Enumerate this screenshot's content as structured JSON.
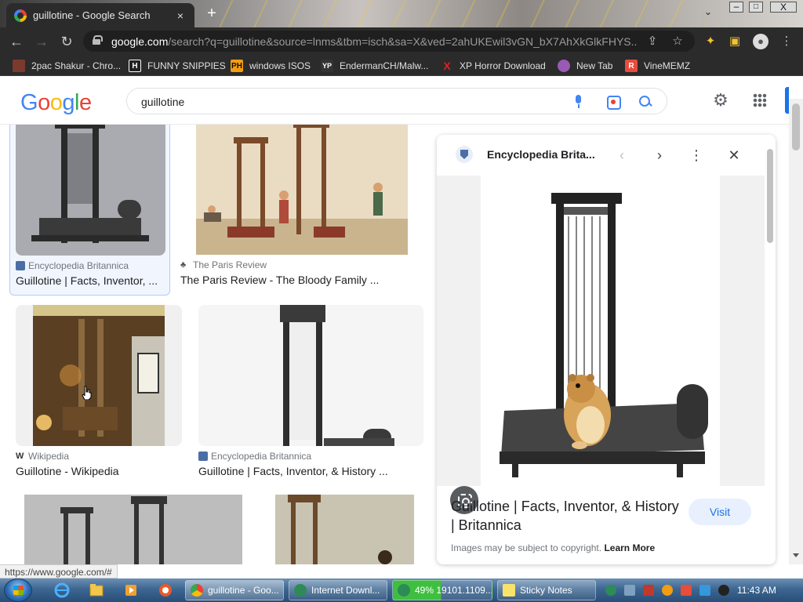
{
  "browser": {
    "tab_title": "guillotine - Google Search",
    "tab_close": "×",
    "new_tab": "+",
    "url_domain": "google.com",
    "url_rest": "/search?q=guillotine&source=lnms&tbm=isch&sa=X&ved=2ahUKEwil3vGN_bX7AhXkGlkFHYS...",
    "window_controls": {
      "minimize": "–",
      "maximize": "□",
      "close": "X"
    }
  },
  "bookmarks": [
    {
      "label": "2pac Shakur - Chro...",
      "icon_text": "",
      "color": "#7a3b2e"
    },
    {
      "label": "FUNNY SNIPPIES",
      "icon_text": "H",
      "color": "#222222"
    },
    {
      "label": "windows ISOS",
      "icon_text": "PH",
      "color": "#f39c12"
    },
    {
      "label": "EndermanCH/Malw...",
      "icon_text": "YP",
      "color": "#333333"
    },
    {
      "label": "XP Horror Download",
      "icon_text": "X",
      "color": "#2b2b2b"
    },
    {
      "label": "New Tab",
      "icon_text": "",
      "color": "#9b59b6"
    },
    {
      "label": "VineMEMZ",
      "icon_text": "R",
      "color": "#e74c3c"
    }
  ],
  "google": {
    "logo_letters": [
      "G",
      "o",
      "o",
      "g",
      "l",
      "e"
    ],
    "query": "guillotine"
  },
  "results": [
    {
      "source": "Encyclopedia Britannica",
      "title": "Guillotine | Facts, Inventor, ..."
    },
    {
      "source": "The Paris Review",
      "title": "The Paris Review - The Bloody Family ..."
    },
    {
      "source": "Wikipedia",
      "title": "Guillotine - Wikipedia"
    },
    {
      "source": "Encyclopedia Britannica",
      "title": "Guillotine | Facts, Inventor, & History ..."
    }
  ],
  "panel": {
    "source": "Encyclopedia Brita...",
    "title": "Guillotine | Facts, Inventor, & History | Britannica",
    "visit_label": "Visit",
    "copyright_text": "Images may be subject to copyright.",
    "learn_more": "Learn More",
    "prev": "‹",
    "next": "›",
    "more": "⋮",
    "close": "✕"
  },
  "status_url": "https://www.google.com/#",
  "taskbar": {
    "tasks": [
      {
        "label": "guillotine - Goo...",
        "color": "#4285f4"
      },
      {
        "label": "Internet Downl...",
        "color": "#2e8b57"
      },
      {
        "label": "49% 19101.1109...",
        "color": "#2e8b57"
      },
      {
        "label": "Sticky Notes",
        "color": "#f7e36b"
      }
    ],
    "clock": "11:43 AM"
  }
}
